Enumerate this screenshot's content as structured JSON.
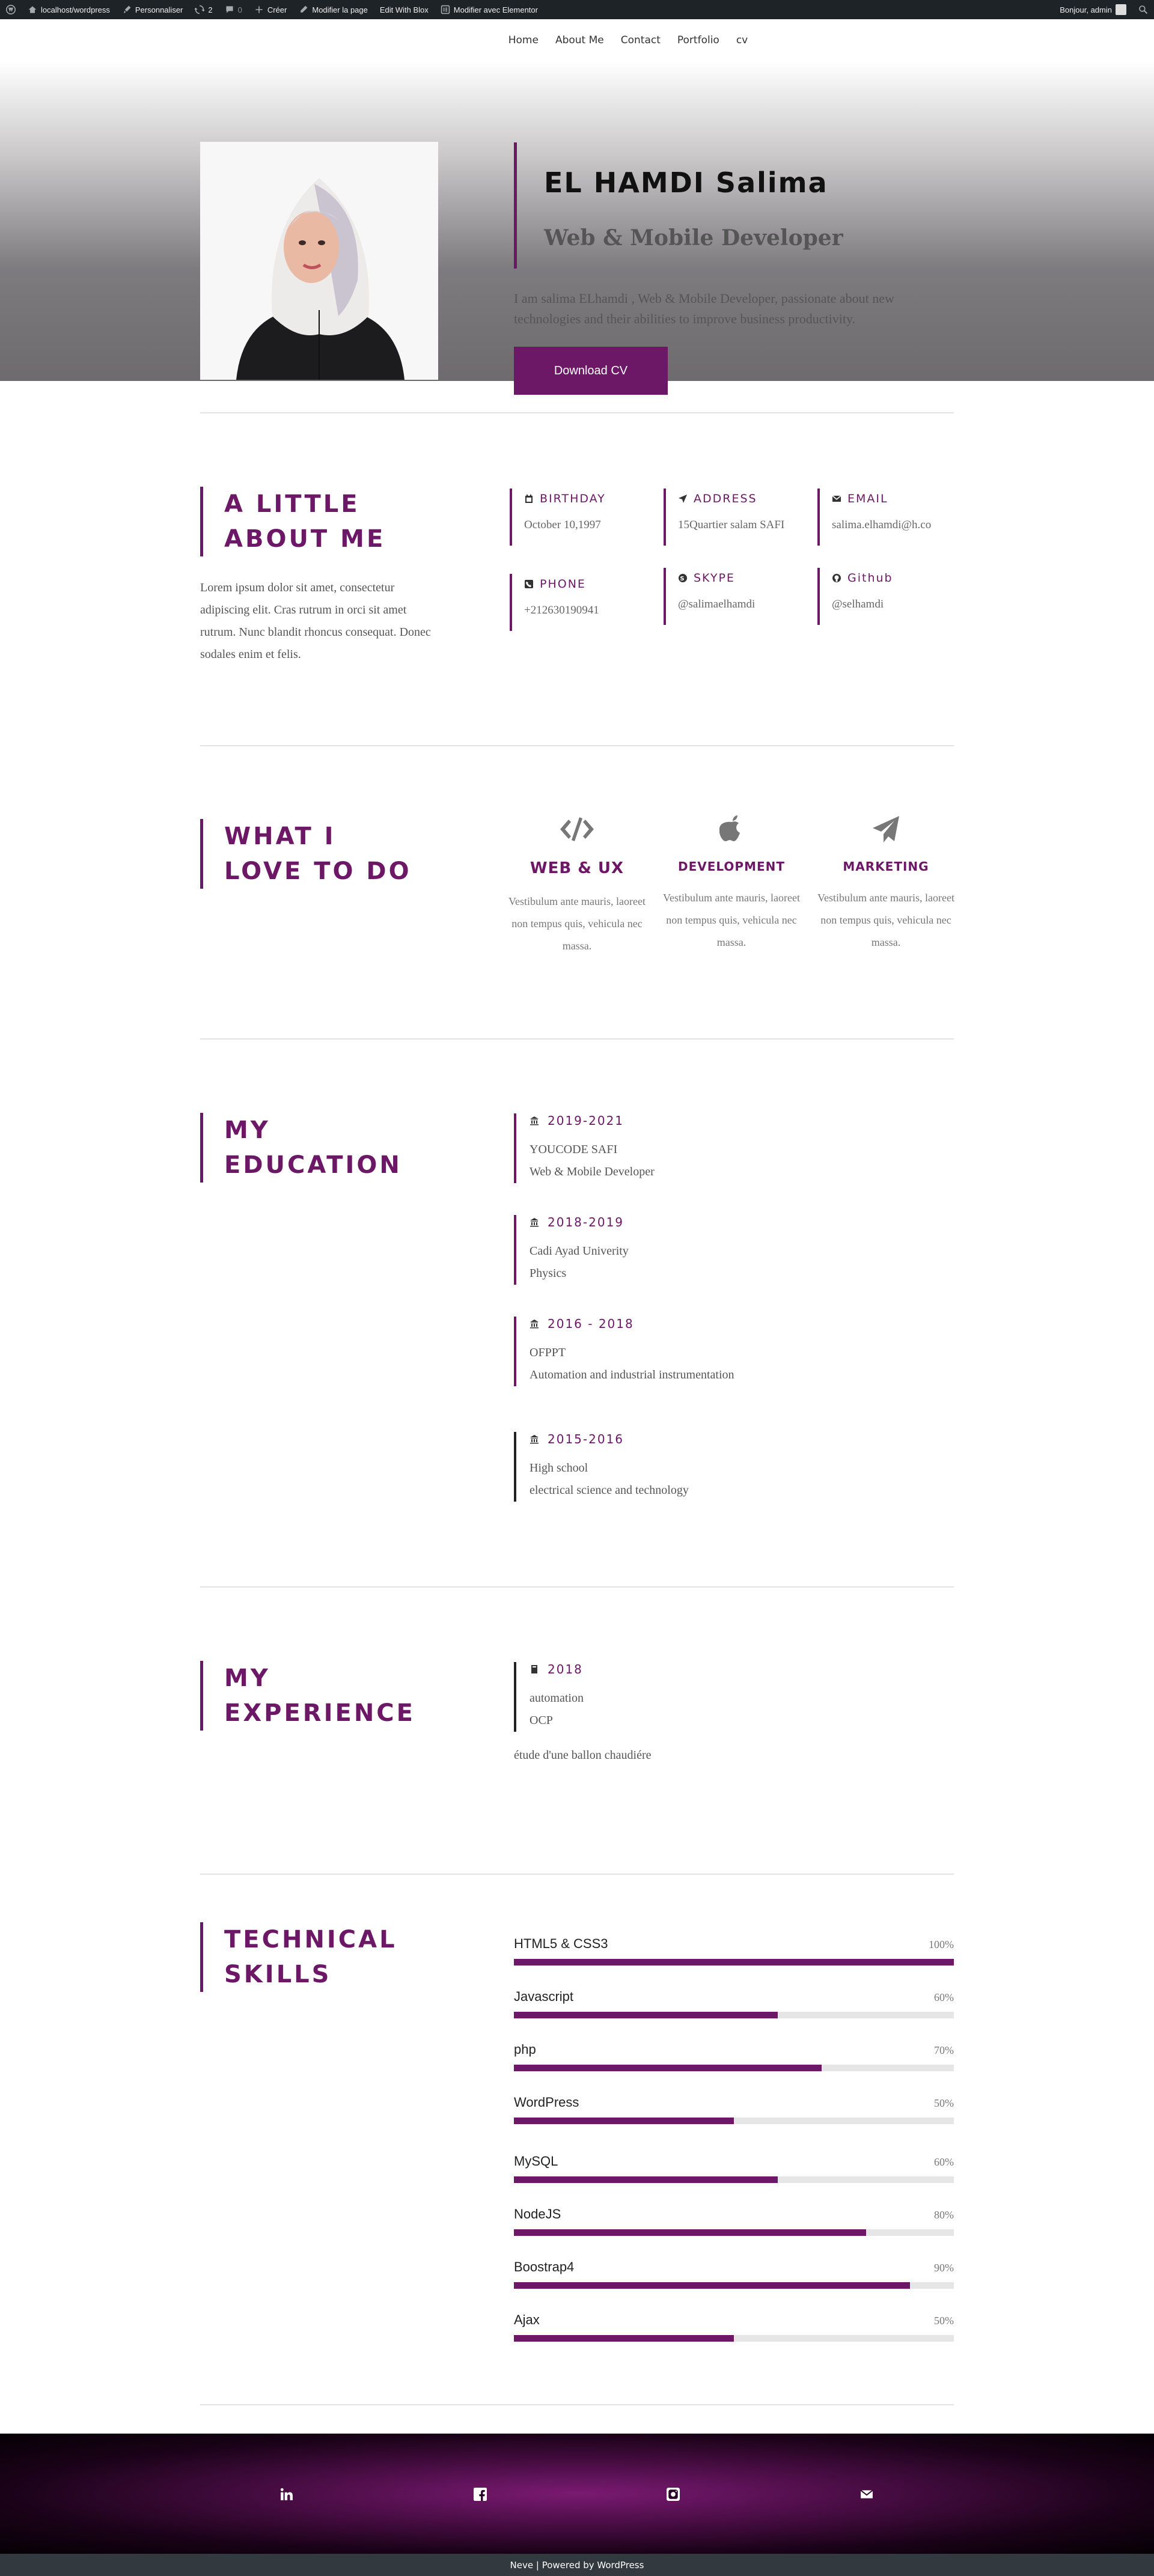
{
  "admin_bar": {
    "site": "localhost/wordpress",
    "customize": "Personnaliser",
    "updates": "2",
    "comments": "0",
    "new": "Créer",
    "edit_page": "Modifier la page",
    "edit_blox": "Edit With Blox",
    "edit_elementor": "Modifier avec Elementor",
    "greeting": "Bonjour, admin"
  },
  "nav": [
    "Home",
    "About Me",
    "Contact",
    "Portfolio",
    "cv"
  ],
  "hero": {
    "name": "EL HAMDI Salima",
    "role": "Web & Mobile Developer",
    "description": "I am salima ELhamdi , Web & Mobile Developer, passionate about new technologies and their abilities to improve business productivity.",
    "cv_button": "Download CV"
  },
  "about": {
    "title_line1": "A LITTLE",
    "title_line2": "ABOUT ME",
    "text": "Lorem ipsum dolor sit amet, consectetur adipiscing elit. Cras rutrum in orci sit amet rutrum. Nunc blandit rhoncus consequat. Donec sodales enim et felis.",
    "info": [
      {
        "label": "BIRTHDAY",
        "value": "October 10,1997",
        "icon": "calendar-icon"
      },
      {
        "label": "ADDRESS",
        "value": "15Quartier salam SAFI",
        "icon": "location-arrow-icon"
      },
      {
        "label": "EMAIL",
        "value": "salima.elhamdi@h.co",
        "icon": "envelope-icon"
      },
      {
        "label": "PHONE",
        "value": "+212630190941",
        "icon": "phone-icon"
      },
      {
        "label": "SKYPE",
        "value": "@salimaelhamdi",
        "icon": "skype-icon"
      },
      {
        "label": "Github",
        "value": "@selhamdi",
        "icon": "github-icon"
      }
    ]
  },
  "services": {
    "title_line1": "WHAT I",
    "title_line2": "LOVE TO DO",
    "items": [
      {
        "title": "WEB & UX",
        "text": "Vestibulum ante mauris, laoreet non tempus quis, vehicula nec massa.",
        "icon": "code-icon"
      },
      {
        "title": "DEVELOPMENT",
        "text": "Vestibulum ante mauris, laoreet non tempus quis, vehicula nec massa.",
        "icon": "apple-icon"
      },
      {
        "title": "MARKETING",
        "text": "Vestibulum ante mauris, laoreet non tempus quis, vehicula nec massa.",
        "icon": "paper-plane-icon"
      }
    ]
  },
  "education": {
    "title_line1": "MY",
    "title_line2": "EDUCATION",
    "items": [
      {
        "years": "2019-2021",
        "school": "YOUCODE SAFI",
        "field": "Web & Mobile Developer"
      },
      {
        "years": "2018-2019",
        "school": "Cadi Ayad Univerity",
        "field": "Physics"
      },
      {
        "years": "2016 - 2018",
        "school": "OFPPT",
        "field": "Automation and industrial instrumentation"
      },
      {
        "years": "2015-2016",
        "school": "High school",
        "field": "electrical science and technology"
      }
    ]
  },
  "experience": {
    "title_line1": "MY",
    "title_line2": "EXPERIENCE",
    "items": [
      {
        "year": "2018",
        "line1": "automation",
        "line2": "OCP"
      }
    ],
    "note": "étude d'une ballon chaudiére"
  },
  "skills": {
    "title_line1": "TECHNICAL",
    "title_line2": "SKILLS",
    "items": [
      {
        "name": "HTML5 & CSS3",
        "percent": 100,
        "label": "100%"
      },
      {
        "name": "Javascript",
        "percent": 60,
        "label": "60%"
      },
      {
        "name": "php",
        "percent": 70,
        "label": "70%"
      },
      {
        "name": "WordPress",
        "percent": 50,
        "label": "50%"
      },
      {
        "name": "MySQL",
        "percent": 60,
        "label": "60%"
      },
      {
        "name": "NodeJS",
        "percent": 80,
        "label": "80%"
      },
      {
        "name": "Boostrap4",
        "percent": 90,
        "label": "90%"
      },
      {
        "name": "Ajax",
        "percent": 50,
        "label": "50%"
      }
    ]
  },
  "footer": {
    "social": [
      "linkedin-icon",
      "facebook-icon",
      "instagram-icon",
      "envelope-icon"
    ],
    "credits": "Neve | Powered by WordPress"
  },
  "colors": {
    "accent": "#6d1767",
    "admin_bar": "#1d2327",
    "credits_bar": "#333a3f"
  }
}
